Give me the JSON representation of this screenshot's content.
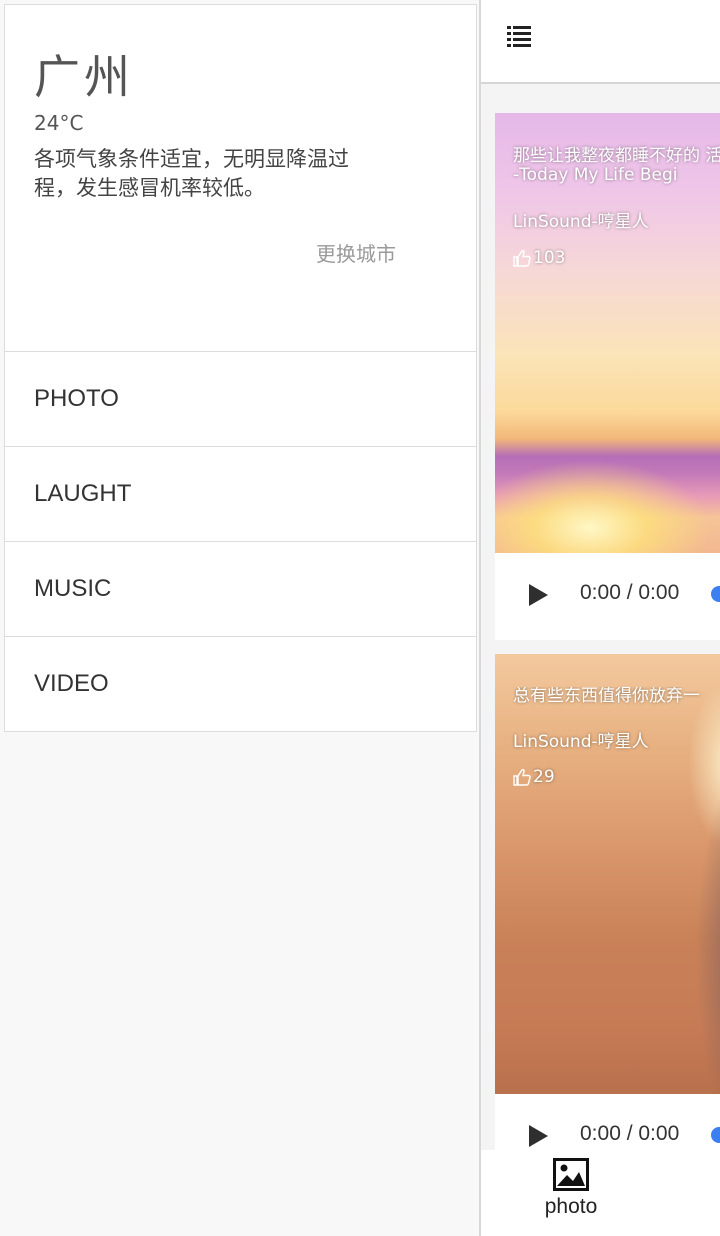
{
  "drawer": {
    "weather": {
      "city": "广州",
      "temperature": "24°C",
      "description": "各项气象条件适宜，无明显降温过程，发生感冒机率较低。",
      "change_city_label": "更换城市"
    },
    "menu": [
      {
        "label": "PHOTO"
      },
      {
        "label": "LAUGHT"
      },
      {
        "label": "MUSIC"
      },
      {
        "label": "VIDEO"
      }
    ]
  },
  "main": {
    "header": {
      "icon": "list-icon"
    },
    "cards": [
      {
        "title": "那些让我整夜都睡不好的 活了 -Today My Life Begi",
        "author": "LinSound-哼星人",
        "likes": "103",
        "time": "0:00 / 0:00"
      },
      {
        "title": "总有些东西值得你放弃一",
        "author": "LinSound-哼星人",
        "likes": "29",
        "time": "0:00 / 0:00"
      }
    ],
    "bottom_nav": {
      "photo_label": "photo",
      "icon": "image-icon"
    }
  },
  "colors": {
    "accent": "#3b7ff0",
    "drawer_bg": "#f8f8f8",
    "card_bg": "#ffffff"
  }
}
